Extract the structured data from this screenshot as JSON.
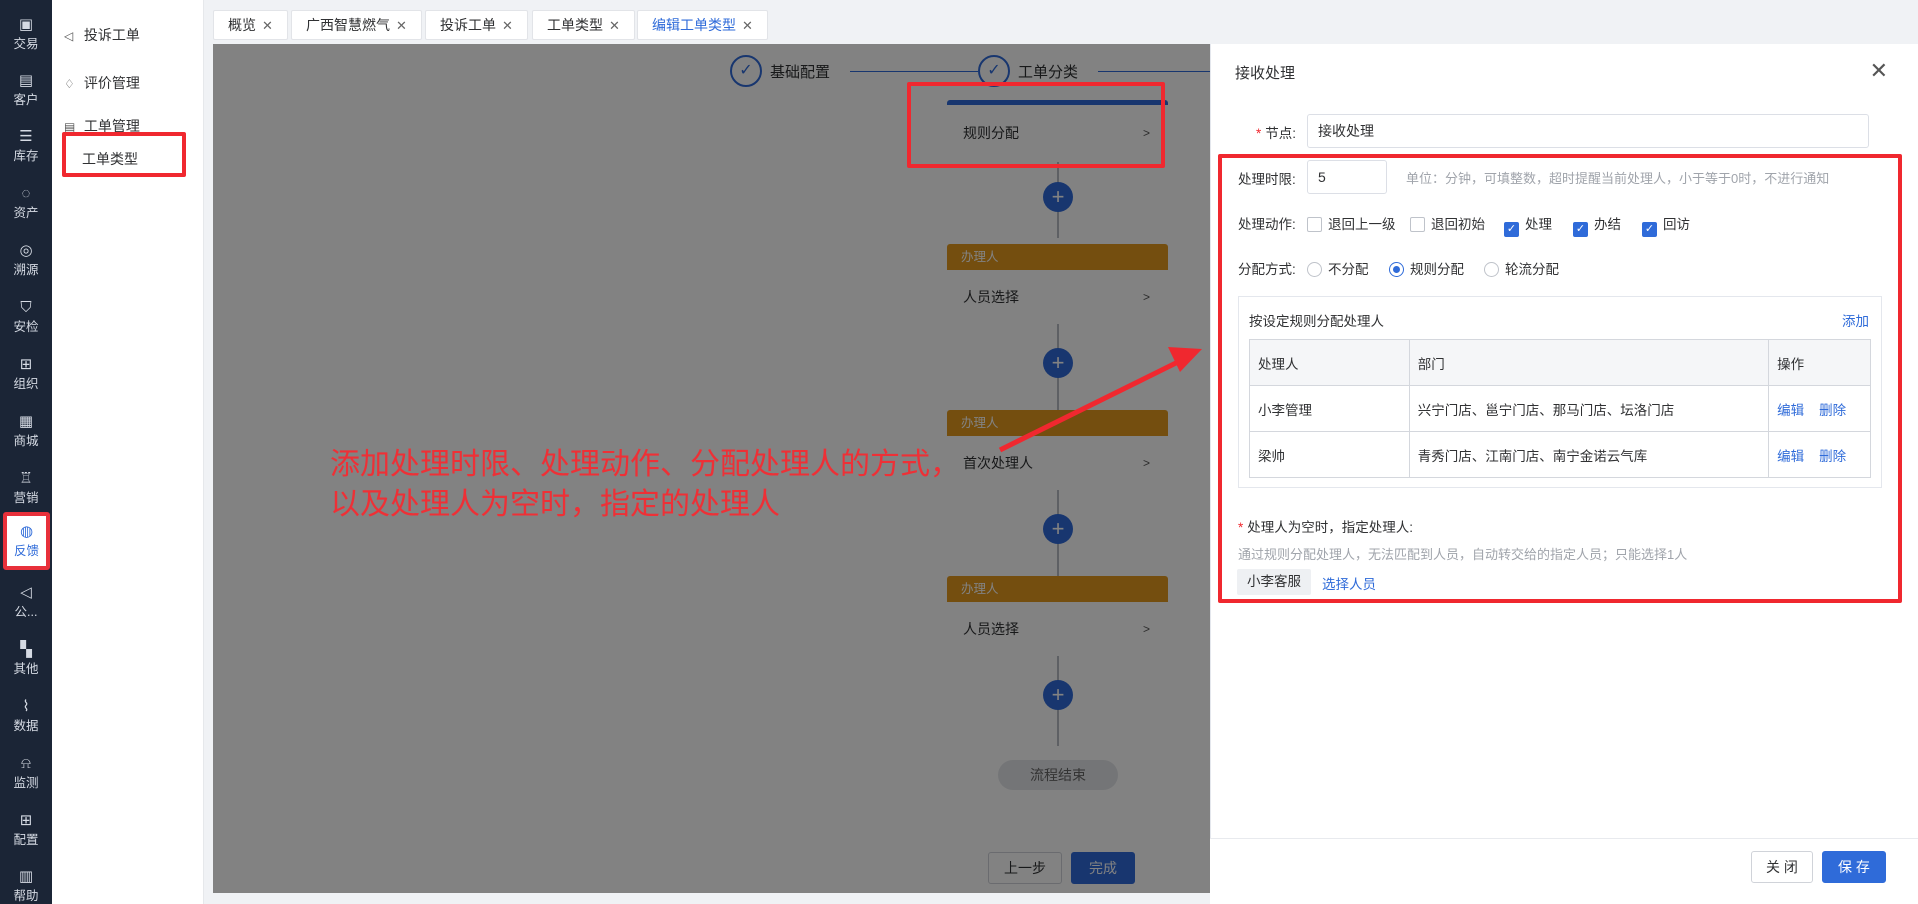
{
  "colors": {
    "primary": "#2f6bd9",
    "highlight": "#f0282f",
    "sidebar_bg": "#1b2536",
    "approver_header": "#e39a1e"
  },
  "rail": [
    {
      "icon": "bag-icon",
      "label": "交易"
    },
    {
      "icon": "id-card-icon",
      "label": "客户"
    },
    {
      "icon": "list-icon",
      "label": "库存"
    },
    {
      "icon": "lightbulb-icon",
      "label": "资产"
    },
    {
      "icon": "compass-icon",
      "label": "溯源"
    },
    {
      "icon": "shield-icon",
      "label": "安检"
    },
    {
      "icon": "org-icon",
      "label": "组织"
    },
    {
      "icon": "store-icon",
      "label": "商城"
    },
    {
      "icon": "trophy-icon",
      "label": "营销"
    },
    {
      "icon": "chat-icon",
      "label": "反馈",
      "active": true
    },
    {
      "icon": "megaphone-icon",
      "label": "公..."
    },
    {
      "icon": "blocks-icon",
      "label": "其他"
    },
    {
      "icon": "chart-icon",
      "label": "数据"
    },
    {
      "icon": "alarm-icon",
      "label": "监测"
    },
    {
      "icon": "grid-icon",
      "label": "配置"
    },
    {
      "icon": "book-icon",
      "label": "帮助"
    }
  ],
  "subnav": {
    "complaint": "投诉工单",
    "evaluation": "评价管理",
    "ticket_manage": "工单管理",
    "ticket_type": "工单类型"
  },
  "tabs": [
    {
      "label": "概览"
    },
    {
      "label": "广西智慧燃气"
    },
    {
      "label": "投诉工单"
    },
    {
      "label": "工单类型"
    },
    {
      "label": "编辑工单类型",
      "active": true
    }
  ],
  "steps": {
    "step1": "基础配置",
    "step2": "工单分类"
  },
  "flow": {
    "rule_card": "规则分配",
    "cards": [
      {
        "header": "办理人",
        "body": "人员选择"
      },
      {
        "header": "办理人",
        "body": "首次处理人"
      },
      {
        "header": "办理人",
        "body": "人员选择"
      }
    ],
    "end": "流程结束",
    "arrow": ">"
  },
  "canvas_buttons": {
    "prev": "上一步",
    "done": "完成"
  },
  "annotation": {
    "line1": "添加处理时限、处理动作、分配处理人的方式，",
    "line2": "以及处理人为空时，指定的处理人"
  },
  "drawer": {
    "title": "接收处理",
    "node_label": "节点:",
    "node_value": "接收处理",
    "time_label": "处理时限:",
    "time_value": "5",
    "time_hint": "单位：分钟，可填整数，超时提醒当前处理人，小于等于0时，不进行通知",
    "action_label": "处理动作:",
    "actions": [
      {
        "label": "退回上一级",
        "checked": false
      },
      {
        "label": "退回初始",
        "checked": false
      },
      {
        "label": "处理",
        "checked": true
      },
      {
        "label": "办结",
        "checked": true
      },
      {
        "label": "回访",
        "checked": true
      }
    ],
    "assign_label": "分配方式:",
    "assign_options": [
      {
        "label": "不分配",
        "checked": false
      },
      {
        "label": "规则分配",
        "checked": true
      },
      {
        "label": "轮流分配",
        "checked": false
      }
    ],
    "rule_title": "按设定规则分配处理人",
    "rule_add": "添加",
    "table_headers": [
      "处理人",
      "部门",
      "操作"
    ],
    "table_rows": [
      {
        "handler": "小李管理",
        "dept": "兴宁门店、邕宁门店、那马门店、坛洛门店",
        "edit": "编辑",
        "del": "删除"
      },
      {
        "handler": "梁帅",
        "dept": "青秀门店、江南门店、南宁金诺云气库",
        "edit": "编辑",
        "del": "删除"
      }
    ],
    "empty_label": "处理人为空时，指定处理人:",
    "empty_hint": "通过规则分配处理人，无法匹配到人员，自动转交给的指定人员；只能选择1人",
    "assignee_tag": "小李客服",
    "select_person": "选择人员",
    "close_button": "关 闭",
    "save_button": "保 存"
  }
}
